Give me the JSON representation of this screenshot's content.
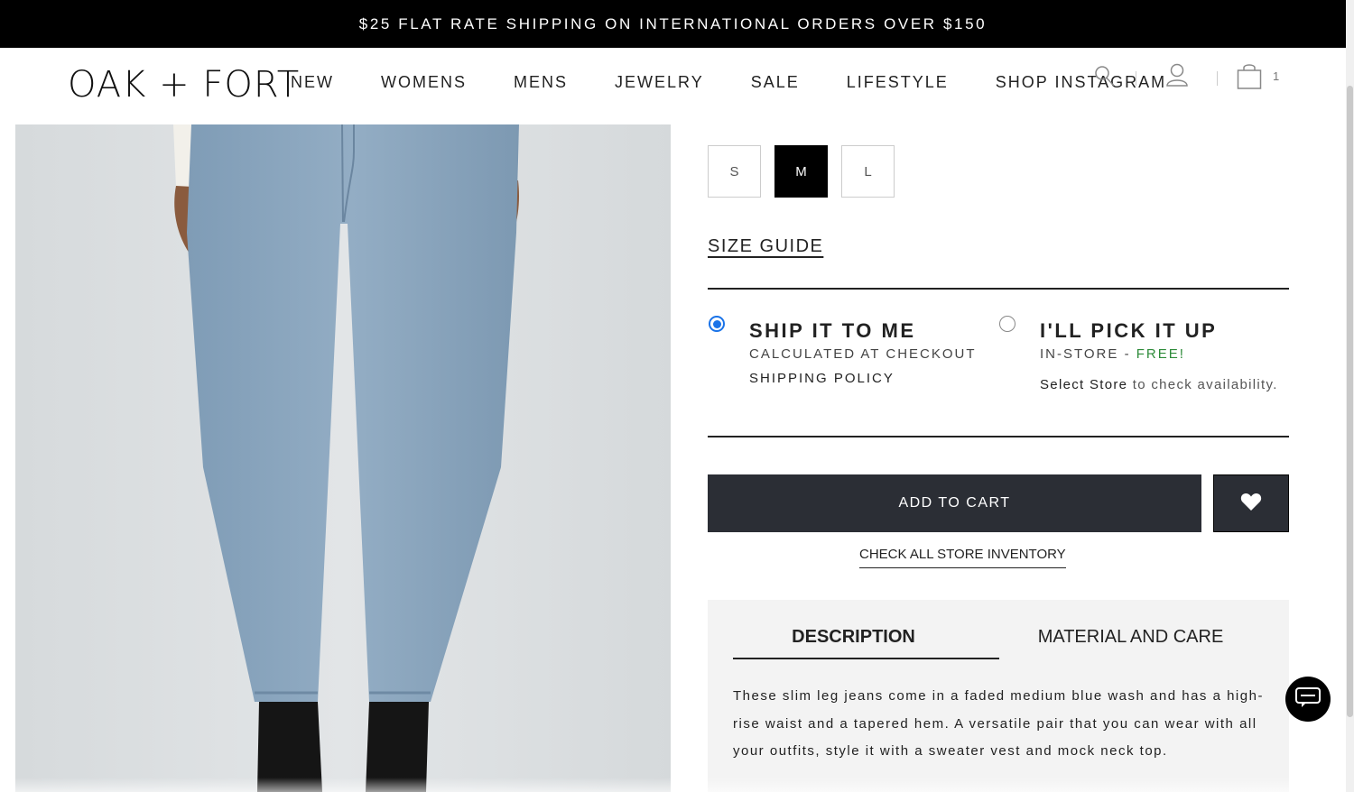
{
  "announcement": "$25 FLAT RATE SHIPPING ON INTERNATIONAL ORDERS OVER $150",
  "header": {
    "logo": "OAK + FORT",
    "nav": [
      "NEW",
      "WOMENS",
      "MENS",
      "JEWELRY",
      "SALE",
      "LIFESTYLE",
      "SHOP INSTAGRAM"
    ],
    "icons": [
      "search-icon",
      "account-icon",
      "shopping-bag-icon"
    ],
    "cart_count": "1"
  },
  "product": {
    "image_alt": "light-wash-jeans-product-photo",
    "sizes": [
      {
        "label": "S",
        "selected": false
      },
      {
        "label": "M",
        "selected": true
      },
      {
        "label": "L",
        "selected": false
      }
    ],
    "size_guide": "SIZE GUIDE"
  },
  "fulfillment": {
    "ship": {
      "title": "SHIP IT TO ME",
      "line1": "CALCULATED AT CHECKOUT",
      "line2": "SHIPPING POLICY",
      "selected": true
    },
    "pickup": {
      "title": "I'LL PICK IT UP",
      "line1_prefix": "IN-STORE - ",
      "line1_free": "FREE!",
      "store_link": "Select Store",
      "store_suffix": " to check availability.",
      "selected": false
    }
  },
  "actions": {
    "add_to_cart": "ADD TO CART",
    "wishlist_icon": "heart-icon",
    "check_inventory": "CHECK ALL STORE INVENTORY"
  },
  "info_tabs": {
    "tabs": [
      "DESCRIPTION",
      "MATERIAL AND CARE"
    ],
    "active": "DESCRIPTION",
    "description": "These slim leg jeans come in a faded medium blue wash and has a high-rise waist and a tapered hem. A versatile pair that you can wear with all your outfits, style it with a sweater vest and mock neck top."
  },
  "colors": {
    "announcement_bg": "#000000",
    "button_dark": "#2b2e35",
    "radio_blue": "#1a73e8",
    "free_green": "#2e8b3a",
    "panel_bg": "#f3f3f3"
  }
}
